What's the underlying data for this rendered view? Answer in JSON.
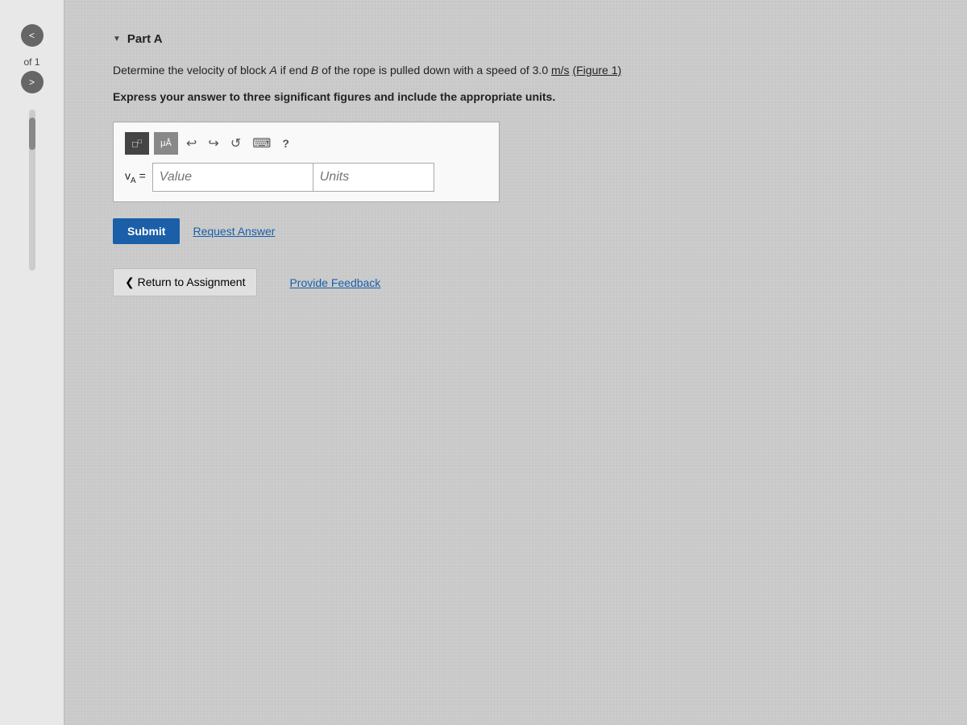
{
  "sidebar": {
    "page_info": "of 1",
    "nav_prev": "<",
    "nav_next": ">"
  },
  "part": {
    "title": "Part A",
    "collapse_symbol": "▼",
    "question_text_1": "Determine the velocity of block ",
    "question_A": "A",
    "question_text_2": " if end ",
    "question_B": "B",
    "question_text_3": " of the rope is pulled down with a speed of 3.0 m/s",
    "question_text_4": ". (Figure 1)",
    "figure_link": "(Figure 1)",
    "instruction": "Express your answer to three significant figures and include the appropriate units.",
    "toolbar": {
      "icon1": "□",
      "icon2": "μÅ",
      "undo": "↩",
      "redo": "↪",
      "reset": "↺",
      "keyboard": "⌨",
      "help": "?"
    },
    "input": {
      "label": "v",
      "subscript": "A",
      "equals": "=",
      "value_placeholder": "Value",
      "units_placeholder": "Units"
    },
    "buttons": {
      "submit": "Submit",
      "request_answer": "Request Answer"
    },
    "bottom": {
      "return_label": "❮ Return to Assignment",
      "provide_feedback": "Provide Feedback"
    }
  }
}
